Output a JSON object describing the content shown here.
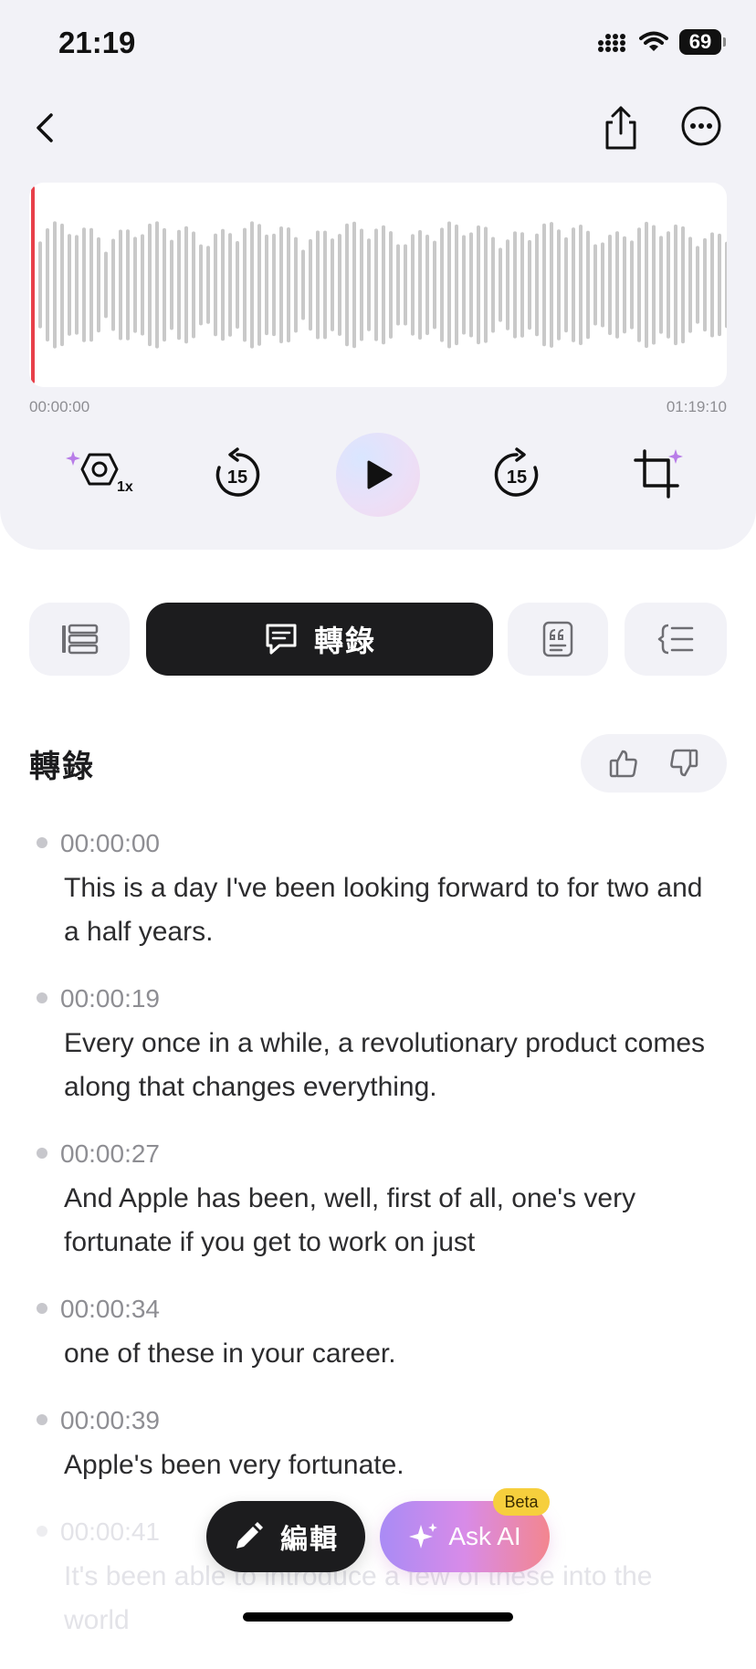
{
  "status_bar": {
    "time": "21:19",
    "battery": "69"
  },
  "player": {
    "time_start": "00:00:00",
    "time_end": "01:19:10",
    "speed_label": "1x",
    "skip_back_label": "15",
    "skip_forward_label": "15"
  },
  "tabs": [
    {
      "icon": "list-icon"
    },
    {
      "icon": "chat-bubble-icon",
      "label": "轉錄",
      "active": true
    },
    {
      "icon": "quote-icon"
    },
    {
      "icon": "outline-icon"
    }
  ],
  "section": {
    "title": "轉錄"
  },
  "transcript": [
    {
      "time": "00:00:00",
      "text": "This is a day I've been looking forward to for two and a half years."
    },
    {
      "time": "00:00:19",
      "text": "Every once in a while, a revolutionary product comes along that changes everything."
    },
    {
      "time": "00:00:27",
      "text": "And Apple has been, well, first of all, one's very fortunate if you get to work on just"
    },
    {
      "time": "00:00:34",
      "text": "one of these in your career."
    },
    {
      "time": "00:00:39",
      "text": "Apple's been very fortunate."
    },
    {
      "time": "00:00:41",
      "text": "It's been able to introduce a few of these into the world"
    }
  ],
  "actions": {
    "edit_label": "編輯",
    "ask_ai_label": "Ask AI",
    "beta_label": "Beta"
  },
  "colors": {
    "accent_dark": "#1c1c1e",
    "playhead": "#e8404a",
    "beta": "#f6cf3d"
  }
}
